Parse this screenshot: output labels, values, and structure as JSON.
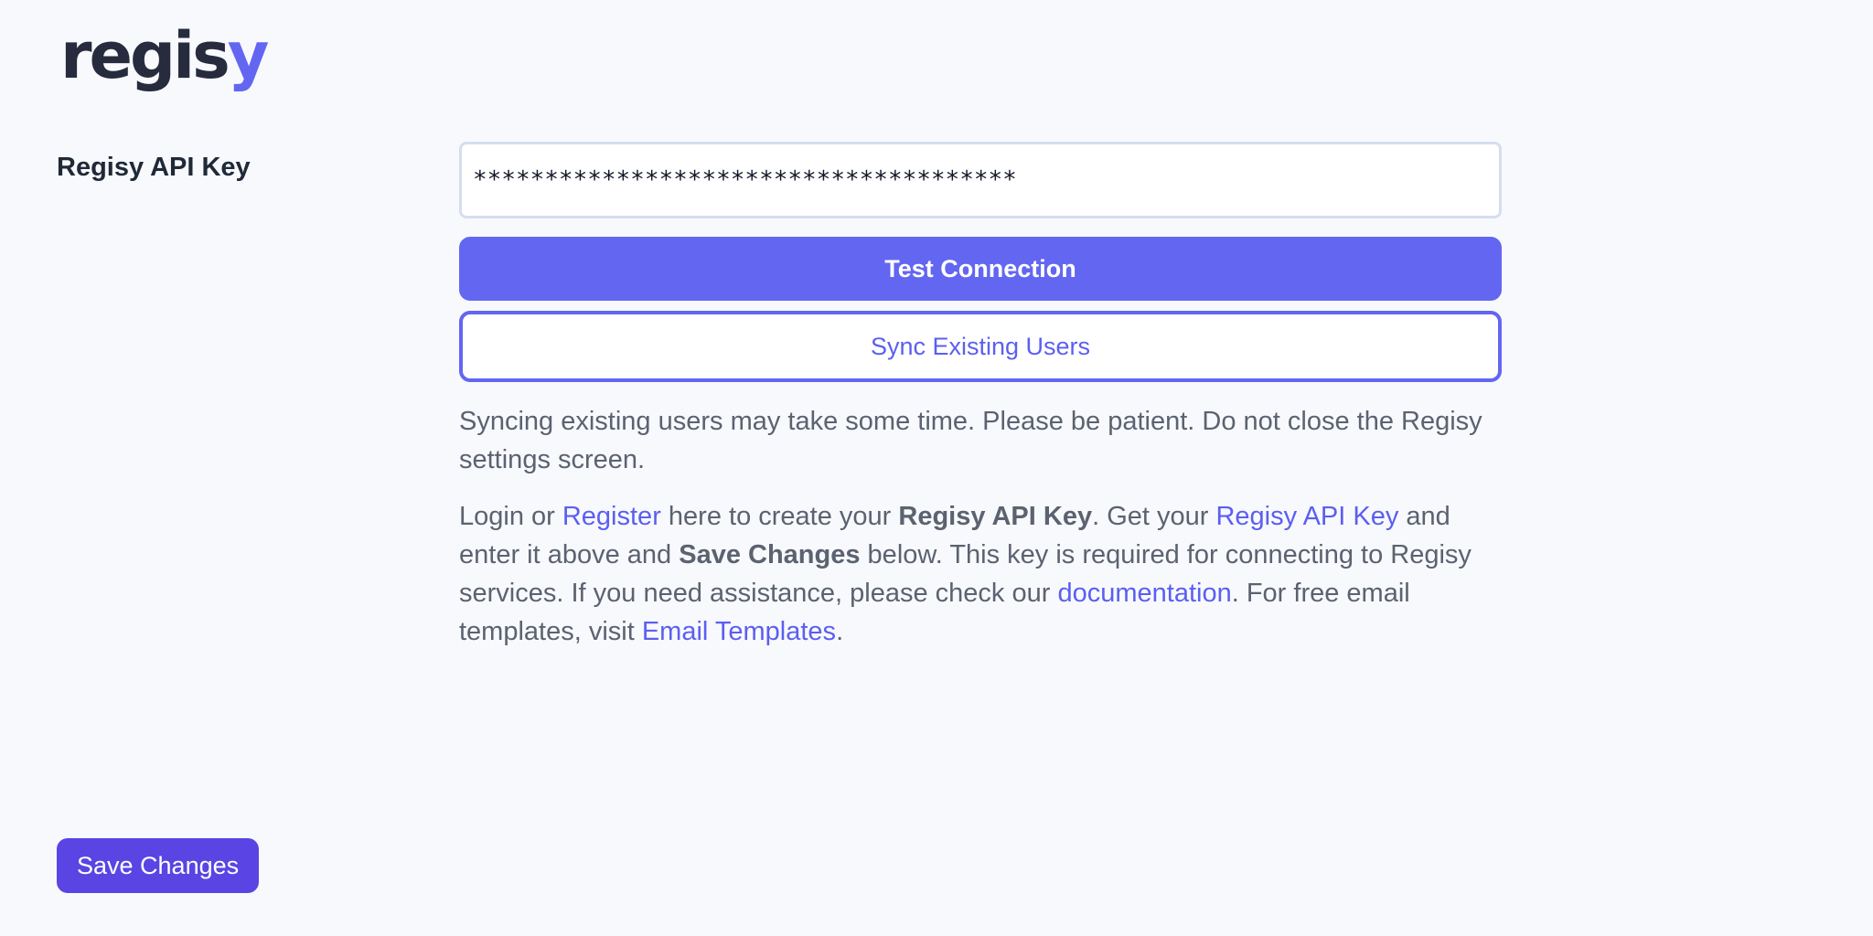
{
  "logo": {
    "text_main": "regis",
    "text_accent": "y"
  },
  "field": {
    "label": "Regisy API Key",
    "value": "**************************************"
  },
  "buttons": {
    "test_connection": "Test Connection",
    "sync_users": "Sync Existing Users",
    "save_changes": "Save Changes"
  },
  "note": "Syncing existing users may take some time. Please be patient. Do not close the Regisy settings screen.",
  "help": {
    "t1": "Login or ",
    "link_register": "Register",
    "t2": " here to create your ",
    "bold_api_key": "Regisy API Key",
    "t3": ". Get your ",
    "link_api_key": "Regisy API Key",
    "t4": " and enter it above and ",
    "bold_save": "Save Changes",
    "t5": " below. This key is required for connecting to Regisy services. If you need assistance, please check our ",
    "link_docs": "documentation",
    "t6": ". For free email templates, visit ",
    "link_templates": "Email Templates",
    "t7": "."
  },
  "colors": {
    "accent": "#6366f1",
    "save_button": "#5a44e3",
    "background": "#f8f9fd",
    "logo_dark": "#262c3e"
  }
}
